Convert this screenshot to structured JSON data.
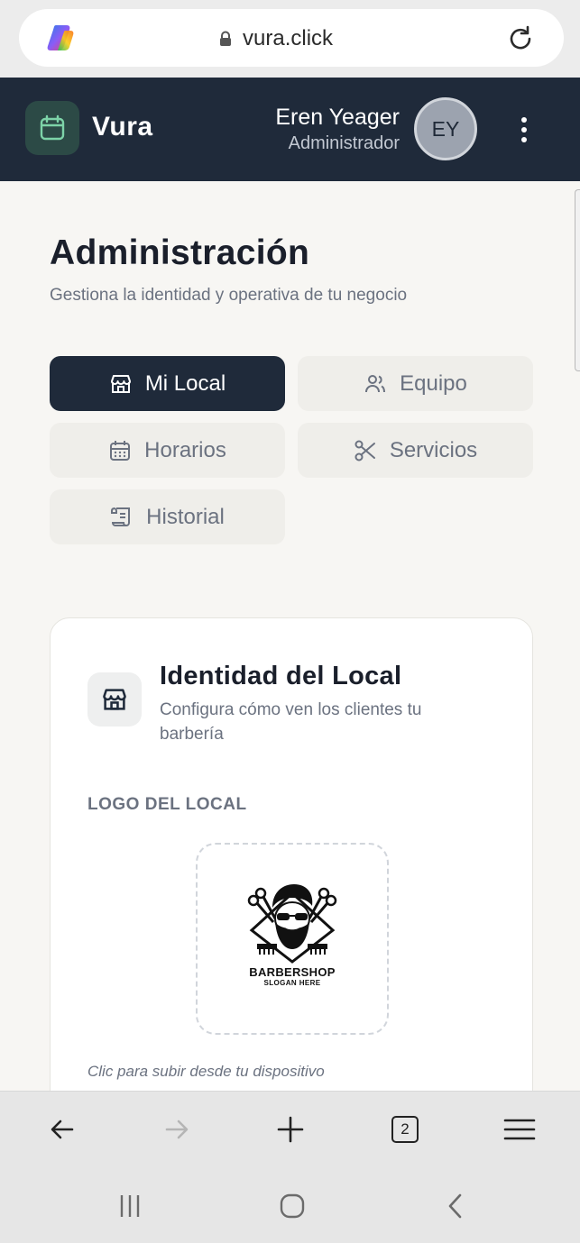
{
  "browser": {
    "url": "vura.click",
    "tabs_count": "2"
  },
  "header": {
    "brand": "Vura",
    "user_name": "Eren Yeager",
    "user_role": "Administrador",
    "avatar_initials": "EY"
  },
  "page": {
    "title": "Administración",
    "subtitle": "Gestiona la identidad y operativa de tu negocio"
  },
  "tabs": [
    {
      "label": "Mi Local",
      "icon": "store-icon",
      "active": true
    },
    {
      "label": "Equipo",
      "icon": "users-icon",
      "active": false
    },
    {
      "label": "Horarios",
      "icon": "calendar-icon",
      "active": false
    },
    {
      "label": "Servicios",
      "icon": "scissors-icon",
      "active": false
    },
    {
      "label": "Historial",
      "icon": "scroll-icon",
      "active": false
    }
  ],
  "card": {
    "title": "Identidad del Local",
    "description": "Configura cómo ven los clientes tu barbería",
    "logo_label": "LOGO DEL LOCAL",
    "logo_name": "BARBERSHOP",
    "logo_slogan": "SLOGAN HERE",
    "upload_hint": "Clic para subir desde tu dispositivo"
  },
  "colors": {
    "header_bg": "#1f2a3a",
    "logo_accent": "#7dd3a8",
    "content_bg": "#f7f6f3",
    "active_tab_bg": "#1f2a3a"
  }
}
